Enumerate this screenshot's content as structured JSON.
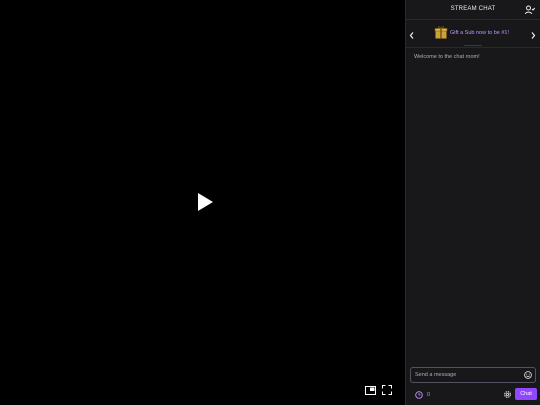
{
  "chat": {
    "title": "STREAM CHAT",
    "gift_banner_text": "Gift a Sub now to be #1!",
    "welcome_message": "Welcome to the chat room!",
    "input_placeholder": "Send a message",
    "points_count": "0",
    "chat_button_label": "Chat"
  },
  "icons": {
    "play": "play-icon",
    "pip": "picture-in-picture-icon",
    "fullscreen": "fullscreen-icon",
    "users": "users-icon",
    "gift": "gift-icon",
    "emote": "emote-icon",
    "points": "channel-points-icon",
    "settings": "gear-icon"
  },
  "colors": {
    "accent": "#9147ff",
    "gift_text": "#bf94ff",
    "panel_bg": "#18181b",
    "video_bg": "#000000"
  }
}
